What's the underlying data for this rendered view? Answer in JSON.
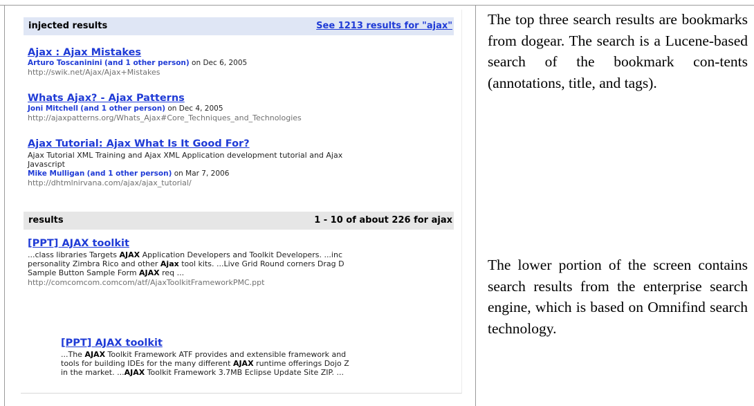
{
  "screenshot": {
    "injected_header": {
      "label": "injected results",
      "see_all_link": "See 1213 results for \"ajax\""
    },
    "injected_results": [
      {
        "title": "Ajax : Ajax Mistakes",
        "person": "Arturo Toscaninini",
        "other": "(and 1 other person)",
        "date": "on Dec 6, 2005",
        "url": "http://swik.net/Ajax/Ajax+Mistakes"
      },
      {
        "title": "Whats Ajax? - Ajax Patterns",
        "person": "Joni Mitchell",
        "other": "(and 1 other person)",
        "date": "on Dec 4, 2005",
        "url": "http://ajaxpatterns.org/Whats_Ajax#Core_Techniques_and_Technologies"
      },
      {
        "title": "Ajax Tutorial: Ajax What Is It Good For?",
        "desc_line1": "Ajax Tutorial XML Training and Ajax XML Application development tutorial and Ajax",
        "desc_line2": "Javascript",
        "person": "Mike Mulligan",
        "other": "(and 1 other person)",
        "date": "on Mar 7, 2006",
        "url": "http://dhtmlnirvana.com/ajax/ajax_tutorial/"
      }
    ],
    "results_header": {
      "label": "results",
      "count": "1 - 10 of about 226 for ajax"
    },
    "results": [
      {
        "title": "[PPT] AJAX toolkit",
        "snippet_line1_a": "...class libraries Targets ",
        "snippet_line1_b": "AJAX",
        "snippet_line1_c": " Application Developers and Toolkit Developers. ...inc",
        "snippet_line2_a": "personality Zimbra Rico and other ",
        "snippet_line2_b": "Ajax",
        "snippet_line2_c": " tool kits. ...Live Grid Round corners Drag D",
        "snippet_line3_a": "Sample Button Sample Form ",
        "snippet_line3_b": "AJAX",
        "snippet_line3_c": " req ...",
        "url": "http://comcomcom.comcom/atf/AjaxToolkitFrameworkPMC.ppt"
      },
      {
        "title": "[PPT] AJAX toolkit",
        "snippet_line1_a": "...The ",
        "snippet_line1_b": "AJAX",
        "snippet_line1_c": " Toolkit Framework ATF provides and extensible framework and",
        "snippet_line2_a": "tools for building IDEs for the many different ",
        "snippet_line2_b": "AJAX",
        "snippet_line2_c": " runtime offerings Dojo Z",
        "snippet_line3_a": "in the market. ...",
        "snippet_line3_b": "AJAX",
        "snippet_line3_c": " Toolkit Framework 3.7MB Eclipse Update Site ZIP. ..."
      }
    ]
  },
  "caption": {
    "top": "The top three search results are bookmarks from dogear. The search is a Lucene-based search of the bookmark con-tents (annotations, title, and tags).",
    "bottom": "The lower portion of the screen contains search results from the enterprise search engine, which is based on Omnifind search technology."
  }
}
